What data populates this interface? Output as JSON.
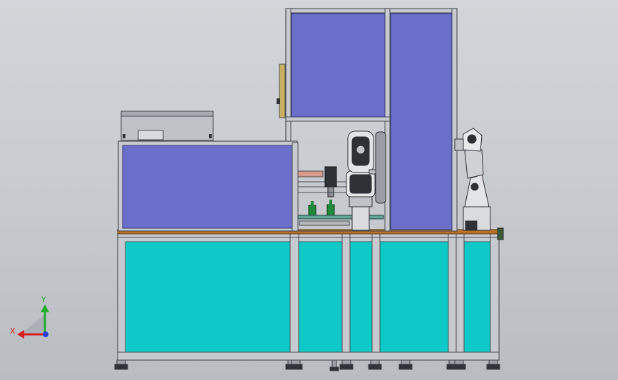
{
  "view": {
    "type": "cad-assembly-front-view",
    "background_top": "#d2d5d9",
    "background_bottom": "#b9bcc1"
  },
  "colors": {
    "frame": "#c7cbd0",
    "frame_edge": "#4a4d52",
    "upper_panel": "#6b6fc9",
    "lower_panel": "#0fc8c8",
    "worktop": "#b8722a",
    "robot": "#bfc2c7",
    "robot_dark": "#2e3036",
    "green_part": "#1f8a3a",
    "axis_x": "#d61f1f",
    "axis_y": "#1fae2c",
    "axis_z": "#2a3fd6"
  },
  "triad": {
    "x_label": "X",
    "y_label": "Y",
    "x_icon": "axis-x-arrow-icon",
    "y_icon": "axis-y-arrow-icon",
    "z_icon": "axis-z-dot-icon"
  }
}
